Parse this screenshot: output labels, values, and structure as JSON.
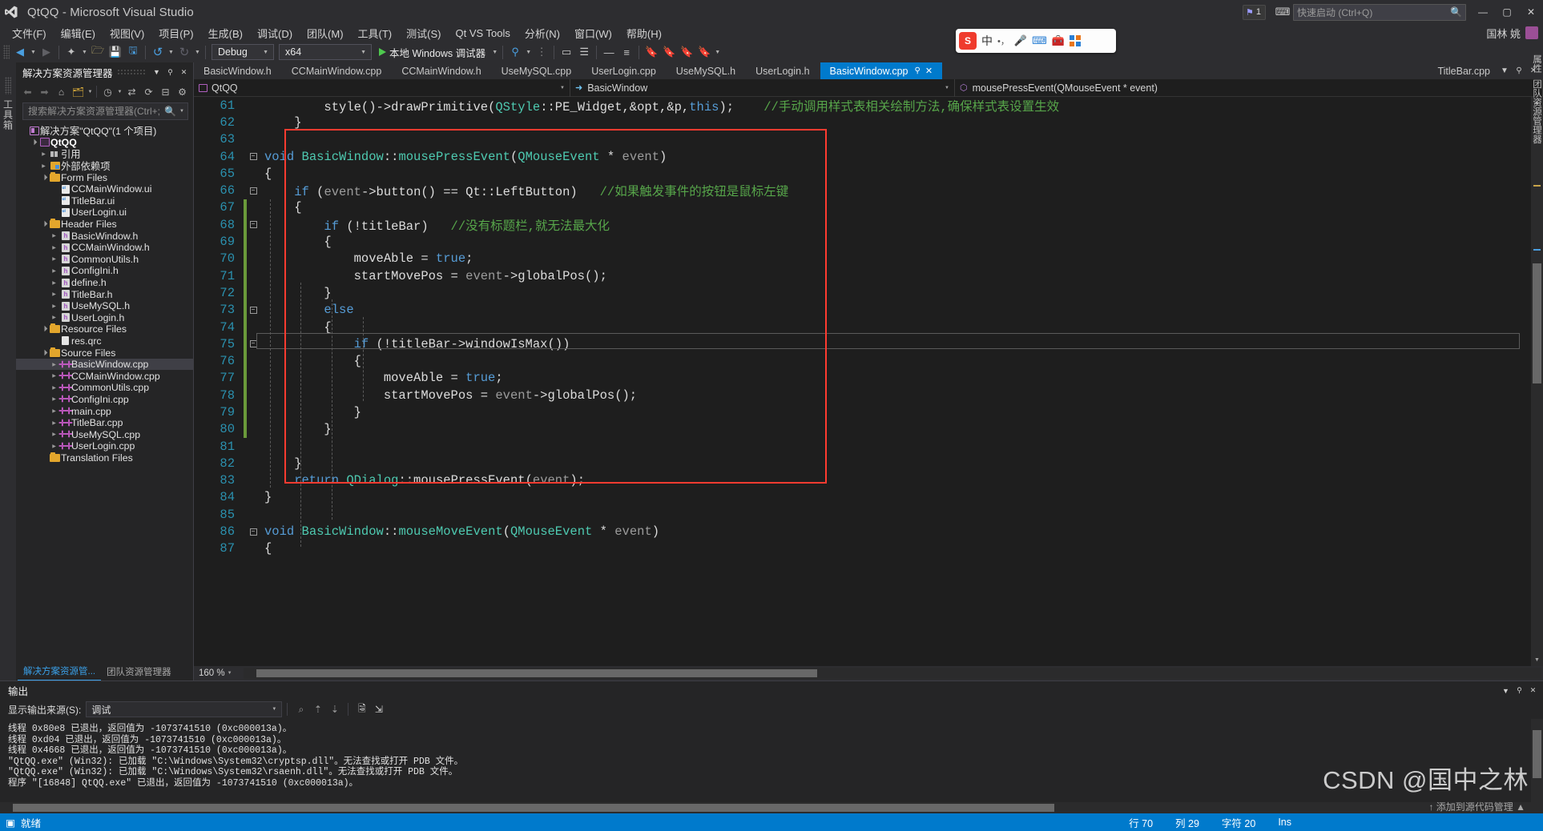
{
  "window": {
    "title": "QtQQ - Microsoft Visual Studio",
    "minimize": "—",
    "maximize": "▢",
    "close": "✕",
    "notification_count": "1",
    "feedback_icon": "feedback-icon",
    "quick_launch_placeholder": "快速启动 (Ctrl+Q)",
    "user_name": "国林 姚"
  },
  "menu": {
    "items": [
      "文件(F)",
      "编辑(E)",
      "视图(V)",
      "项目(P)",
      "生成(B)",
      "调试(D)",
      "团队(M)",
      "工具(T)",
      "测试(S)",
      "Qt VS Tools",
      "分析(N)",
      "窗口(W)",
      "帮助(H)"
    ]
  },
  "toolbar": {
    "back_icon": "navigate-back-icon",
    "forward_icon": "navigate-forward-icon",
    "new_project_icon": "new-project-icon",
    "open_file_icon": "open-file-icon",
    "save_icon": "save-icon",
    "save_all_icon": "save-all-icon",
    "undo_icon": "undo-icon",
    "redo_icon": "redo-icon",
    "config_value": "Debug",
    "platform_value": "x64",
    "run_label": "本地 Windows 调试器",
    "attach_icon": "attach-process-icon",
    "layout_icon": "window-layout-icon",
    "list_icon": "list-icon",
    "minus_icon": "minus-icon",
    "equals_icon": "equals-icon",
    "bookmark_icon": "bookmark-icon"
  },
  "ime_sticker": {
    "logo": "S",
    "mode": "中",
    "dot": "•",
    "comma": "，",
    "mic_icon": "microphone-icon",
    "keyboard_icon": "keyboard-icon",
    "toolbox_icon": "toolbox-icon",
    "apps_icon": "apps-grid-icon"
  },
  "left_strip": {
    "label": "工具箱"
  },
  "solution_explorer": {
    "title": "解决方案资源管理器",
    "header_dropdown_icon": "chevron-down-icon",
    "header_pin_icon": "pin-icon",
    "header_close_icon": "close-icon",
    "tools": {
      "back_icon": "back-arrow-icon",
      "forward_icon": "forward-arrow-icon",
      "home_icon": "home-icon",
      "pending_changes_icon": "pending-changes-icon",
      "view_dropdown_icon": "chevron-down-icon",
      "history_icon": "history-icon",
      "sync_icon": "sync-with-active-document-icon",
      "refresh_icon": "refresh-icon",
      "collapse_icon": "collapse-all-icon",
      "properties_icon": "properties-icon"
    },
    "search_placeholder": "搜索解决方案资源管理器(Ctrl+;",
    "search_value": "",
    "search_icon": "search-icon",
    "search_dropdown_icon": "chevron-down-icon",
    "tree": [
      {
        "label": "解决方案\"QtQQ\"(1 个项目)",
        "icon": "solution-icon",
        "indent": 0,
        "twisty": "none",
        "bold": false
      },
      {
        "label": "QtQQ",
        "icon": "project-icon",
        "indent": 1,
        "twisty": "open",
        "bold": true
      },
      {
        "label": "引用",
        "icon": "references-icon",
        "indent": 2,
        "twisty": "closed",
        "bold": false
      },
      {
        "label": "外部依赖项",
        "icon": "external-dependencies-icon",
        "indent": 2,
        "twisty": "closed",
        "bold": false
      },
      {
        "label": "Form Files",
        "icon": "folder-icon",
        "indent": 2,
        "twisty": "open",
        "bold": false
      },
      {
        "label": "CCMainWindow.ui",
        "icon": "ui-file-icon",
        "indent": 3,
        "twisty": "none",
        "bold": false
      },
      {
        "label": "TitleBar.ui",
        "icon": "ui-file-icon",
        "indent": 3,
        "twisty": "none",
        "bold": false
      },
      {
        "label": "UserLogin.ui",
        "icon": "ui-file-icon",
        "indent": 3,
        "twisty": "none",
        "bold": false
      },
      {
        "label": "Header Files",
        "icon": "folder-icon",
        "indent": 2,
        "twisty": "open",
        "bold": false
      },
      {
        "label": "BasicWindow.h",
        "icon": "header-file-icon",
        "indent": 3,
        "twisty": "closed",
        "bold": false
      },
      {
        "label": "CCMainWindow.h",
        "icon": "header-file-icon",
        "indent": 3,
        "twisty": "closed",
        "bold": false
      },
      {
        "label": "CommonUtils.h",
        "icon": "header-file-icon",
        "indent": 3,
        "twisty": "closed",
        "bold": false
      },
      {
        "label": "ConfigIni.h",
        "icon": "header-file-icon",
        "indent": 3,
        "twisty": "closed",
        "bold": false
      },
      {
        "label": "define.h",
        "icon": "header-file-icon",
        "indent": 3,
        "twisty": "closed",
        "bold": false
      },
      {
        "label": "TitleBar.h",
        "icon": "header-file-icon",
        "indent": 3,
        "twisty": "closed",
        "bold": false
      },
      {
        "label": "UseMySQL.h",
        "icon": "header-file-icon",
        "indent": 3,
        "twisty": "closed",
        "bold": false
      },
      {
        "label": "UserLogin.h",
        "icon": "header-file-icon",
        "indent": 3,
        "twisty": "closed",
        "bold": false
      },
      {
        "label": "Resource Files",
        "icon": "folder-icon",
        "indent": 2,
        "twisty": "open",
        "bold": false
      },
      {
        "label": "res.qrc",
        "icon": "file-icon",
        "indent": 3,
        "twisty": "none",
        "bold": false
      },
      {
        "label": "Source Files",
        "icon": "folder-icon",
        "indent": 2,
        "twisty": "open",
        "bold": false
      },
      {
        "label": "BasicWindow.cpp",
        "icon": "cpp-file-icon",
        "indent": 3,
        "twisty": "closed",
        "bold": false,
        "selected": true
      },
      {
        "label": "CCMainWindow.cpp",
        "icon": "cpp-file-icon",
        "indent": 3,
        "twisty": "closed",
        "bold": false
      },
      {
        "label": "CommonUtils.cpp",
        "icon": "cpp-file-icon",
        "indent": 3,
        "twisty": "closed",
        "bold": false
      },
      {
        "label": "ConfigIni.cpp",
        "icon": "cpp-file-icon",
        "indent": 3,
        "twisty": "closed",
        "bold": false
      },
      {
        "label": "main.cpp",
        "icon": "cpp-file-icon",
        "indent": 3,
        "twisty": "closed",
        "bold": false
      },
      {
        "label": "TitleBar.cpp",
        "icon": "cpp-file-icon",
        "indent": 3,
        "twisty": "closed",
        "bold": false
      },
      {
        "label": "UseMySQL.cpp",
        "icon": "cpp-file-icon",
        "indent": 3,
        "twisty": "closed",
        "bold": false
      },
      {
        "label": "UserLogin.cpp",
        "icon": "cpp-file-icon",
        "indent": 3,
        "twisty": "closed",
        "bold": false
      },
      {
        "label": "Translation Files",
        "icon": "folder-icon",
        "indent": 2,
        "twisty": "none",
        "bold": false
      }
    ],
    "bottom_tabs": [
      {
        "label": "解决方案资源管...",
        "active": true
      },
      {
        "label": "团队资源管理器",
        "active": false
      }
    ]
  },
  "editor": {
    "tabs": [
      {
        "label": "BasicWindow.h",
        "active": false
      },
      {
        "label": "CCMainWindow.cpp",
        "active": false
      },
      {
        "label": "CCMainWindow.h",
        "active": false
      },
      {
        "label": "UseMySQL.cpp",
        "active": false
      },
      {
        "label": "UserLogin.cpp",
        "active": false
      },
      {
        "label": "UseMySQL.h",
        "active": false
      },
      {
        "label": "UserLogin.h",
        "active": false
      },
      {
        "label": "BasicWindow.cpp",
        "active": true,
        "pin_icon": "pin-icon",
        "close_icon": "close-icon"
      }
    ],
    "right_tab": "TitleBar.cpp",
    "nav": {
      "project": "QtQQ",
      "class": "BasicWindow",
      "member": "mousePressEvent(QMouseEvent * event)",
      "project_icon": "project-icon",
      "class_icon": "class-icon",
      "member_icon": "method-icon",
      "dropdown_icon": "chevron-down-icon"
    },
    "zoom": "160 %",
    "zoom_dropdown_icon": "chevron-down-icon",
    "lines": [
      {
        "n": 61,
        "indent": 0,
        "fold": "",
        "change": false,
        "tokens": [
          {
            "t": "        style",
            "c": "f"
          },
          {
            "t": "()->",
            "c": "f"
          },
          {
            "t": "drawPrimitive",
            "c": "f"
          },
          {
            "t": "(",
            "c": "f"
          },
          {
            "t": "QStyle",
            "c": "t"
          },
          {
            "t": "::PE_Widget,&opt,&p,",
            "c": "f"
          },
          {
            "t": "this",
            "c": "k"
          },
          {
            "t": ");",
            "c": "f"
          },
          {
            "t": "    //手动调用样式表相关绘制方法,确保样式表设置生效",
            "c": "c"
          }
        ]
      },
      {
        "n": 62,
        "indent": 0,
        "fold": "",
        "change": false,
        "tokens": [
          {
            "t": "    }",
            "c": "f"
          }
        ]
      },
      {
        "n": 63,
        "indent": 0,
        "fold": "",
        "change": false,
        "tokens": [
          {
            "t": "",
            "c": "f"
          }
        ]
      },
      {
        "n": 64,
        "indent": 0,
        "fold": "minus",
        "change": false,
        "tokens": [
          {
            "t": "void ",
            "c": "k"
          },
          {
            "t": "BasicWindow",
            "c": "t"
          },
          {
            "t": "::",
            "c": "f"
          },
          {
            "t": "mousePressEvent",
            "c": "t"
          },
          {
            "t": "(",
            "c": "f"
          },
          {
            "t": "QMouseEvent",
            "c": "t"
          },
          {
            "t": " * ",
            "c": "f"
          },
          {
            "t": "event",
            "c": "p"
          },
          {
            "t": ")",
            "c": "f"
          }
        ]
      },
      {
        "n": 65,
        "indent": 0,
        "fold": "",
        "change": false,
        "tokens": [
          {
            "t": "{",
            "c": "f"
          }
        ]
      },
      {
        "n": 66,
        "indent": 0,
        "fold": "minus",
        "change": false,
        "tokens": [
          {
            "t": "    if ",
            "c": "k"
          },
          {
            "t": "(",
            "c": "f"
          },
          {
            "t": "event",
            "c": "p"
          },
          {
            "t": "->button() == Qt::LeftButton)",
            "c": "f"
          },
          {
            "t": "   //如果触发事件的按钮是鼠标左键",
            "c": "c"
          }
        ]
      },
      {
        "n": 67,
        "indent": 0,
        "fold": "",
        "change": true,
        "tokens": [
          {
            "t": "    {",
            "c": "f"
          }
        ]
      },
      {
        "n": 68,
        "indent": 0,
        "fold": "minus",
        "change": true,
        "tokens": [
          {
            "t": "        if ",
            "c": "k"
          },
          {
            "t": "(!titleBar)",
            "c": "f"
          },
          {
            "t": "   //没有标题栏,就无法最大化",
            "c": "c"
          }
        ]
      },
      {
        "n": 69,
        "indent": 0,
        "fold": "",
        "change": true,
        "tokens": [
          {
            "t": "        {",
            "c": "f"
          }
        ]
      },
      {
        "n": 70,
        "indent": 0,
        "fold": "",
        "change": true,
        "current": true,
        "tokens": [
          {
            "t": "            moveAble = ",
            "c": "f"
          },
          {
            "t": "true",
            "c": "k"
          },
          {
            "t": ";",
            "c": "f"
          }
        ]
      },
      {
        "n": 71,
        "indent": 0,
        "fold": "",
        "change": true,
        "tokens": [
          {
            "t": "            startMovePos = ",
            "c": "f"
          },
          {
            "t": "event",
            "c": "p"
          },
          {
            "t": "->globalPos();",
            "c": "f"
          }
        ]
      },
      {
        "n": 72,
        "indent": 0,
        "fold": "",
        "change": true,
        "tokens": [
          {
            "t": "        }",
            "c": "f"
          }
        ]
      },
      {
        "n": 73,
        "indent": 0,
        "fold": "minus",
        "change": true,
        "tokens": [
          {
            "t": "        else",
            "c": "k"
          }
        ]
      },
      {
        "n": 74,
        "indent": 0,
        "fold": "",
        "change": true,
        "tokens": [
          {
            "t": "        {",
            "c": "f"
          }
        ]
      },
      {
        "n": 75,
        "indent": 0,
        "fold": "minus",
        "change": true,
        "tokens": [
          {
            "t": "            if ",
            "c": "k"
          },
          {
            "t": "(!titleBar->windowIsMax())",
            "c": "f"
          }
        ]
      },
      {
        "n": 76,
        "indent": 0,
        "fold": "",
        "change": true,
        "tokens": [
          {
            "t": "            {",
            "c": "f"
          }
        ]
      },
      {
        "n": 77,
        "indent": 0,
        "fold": "",
        "change": true,
        "tokens": [
          {
            "t": "                moveAble = ",
            "c": "f"
          },
          {
            "t": "true",
            "c": "k"
          },
          {
            "t": ";",
            "c": "f"
          }
        ]
      },
      {
        "n": 78,
        "indent": 0,
        "fold": "",
        "change": true,
        "tokens": [
          {
            "t": "                startMovePos = ",
            "c": "f"
          },
          {
            "t": "event",
            "c": "p"
          },
          {
            "t": "->globalPos();",
            "c": "f"
          }
        ]
      },
      {
        "n": 79,
        "indent": 0,
        "fold": "",
        "change": true,
        "tokens": [
          {
            "t": "            }",
            "c": "f"
          }
        ]
      },
      {
        "n": 80,
        "indent": 0,
        "fold": "",
        "change": true,
        "tokens": [
          {
            "t": "        }",
            "c": "f"
          }
        ]
      },
      {
        "n": 81,
        "indent": 0,
        "fold": "",
        "change": false,
        "tokens": [
          {
            "t": "",
            "c": "f"
          }
        ]
      },
      {
        "n": 82,
        "indent": 0,
        "fold": "",
        "change": false,
        "tokens": [
          {
            "t": "    }",
            "c": "f"
          }
        ]
      },
      {
        "n": 83,
        "indent": 0,
        "fold": "",
        "change": false,
        "tokens": [
          {
            "t": "    return ",
            "c": "k"
          },
          {
            "t": "QDialog",
            "c": "t"
          },
          {
            "t": "::mousePressEvent(",
            "c": "f"
          },
          {
            "t": "event",
            "c": "p"
          },
          {
            "t": ");",
            "c": "f"
          }
        ]
      },
      {
        "n": 84,
        "indent": 0,
        "fold": "",
        "change": false,
        "tokens": [
          {
            "t": "}",
            "c": "f"
          }
        ]
      },
      {
        "n": 85,
        "indent": 0,
        "fold": "",
        "change": false,
        "tokens": [
          {
            "t": "",
            "c": "f"
          }
        ]
      },
      {
        "n": 86,
        "indent": 0,
        "fold": "minus",
        "change": false,
        "tokens": [
          {
            "t": "void ",
            "c": "k"
          },
          {
            "t": "BasicWindow",
            "c": "t"
          },
          {
            "t": "::",
            "c": "f"
          },
          {
            "t": "mouseMoveEvent",
            "c": "t"
          },
          {
            "t": "(",
            "c": "f"
          },
          {
            "t": "QMouseEvent",
            "c": "t"
          },
          {
            "t": " * ",
            "c": "f"
          },
          {
            "t": "event",
            "c": "p"
          },
          {
            "t": ")",
            "c": "f"
          }
        ]
      },
      {
        "n": 87,
        "indent": 0,
        "fold": "",
        "change": false,
        "tokens": [
          {
            "t": "{",
            "c": "f"
          }
        ]
      }
    ]
  },
  "output": {
    "title": "输出",
    "dropdown_icon": "chevron-down-icon",
    "pin_icon": "pin-icon",
    "close_icon": "close-icon",
    "source_label": "显示输出来源(S):",
    "source_value": "调试",
    "tools": {
      "find_message_icon": "find-message-icon",
      "prev_icon": "previous-message-icon",
      "next_icon": "next-message-icon",
      "clear_icon": "clear-all-icon",
      "wordwrap_icon": "toggle-word-wrap-icon"
    },
    "lines": [
      "线程 0x80e8 已退出，返回值为 -1073741510 (0xc000013a)。",
      "线程 0xd04 已退出，返回值为 -1073741510 (0xc000013a)。",
      "线程 0x4668 已退出，返回值为 -1073741510 (0xc000013a)。",
      "\"QtQQ.exe\" (Win32): 已加载 \"C:\\Windows\\System32\\cryptsp.dll\"。无法查找或打开 PDB 文件。",
      "\"QtQQ.exe\" (Win32): 已加载 \"C:\\Windows\\System32\\rsaenh.dll\"。无法查找或打开 PDB 文件。",
      "程序 \"[16848] QtQQ.exe\" 已退出，返回值为 -1073741510 (0xc000013a)。"
    ]
  },
  "statusbar": {
    "ready_icon": "ready-icon",
    "ready": "就绪",
    "line": "行 70",
    "col": "列 29",
    "ch": "字符 20",
    "ins": "Ins",
    "add_to_source_control": "↑ 添加到源代码管理 ▲"
  },
  "watermark": {
    "main": "CSDN @国中之林"
  },
  "right_edge": {
    "label_1": "属性",
    "label_2": "团队资源管理器"
  }
}
